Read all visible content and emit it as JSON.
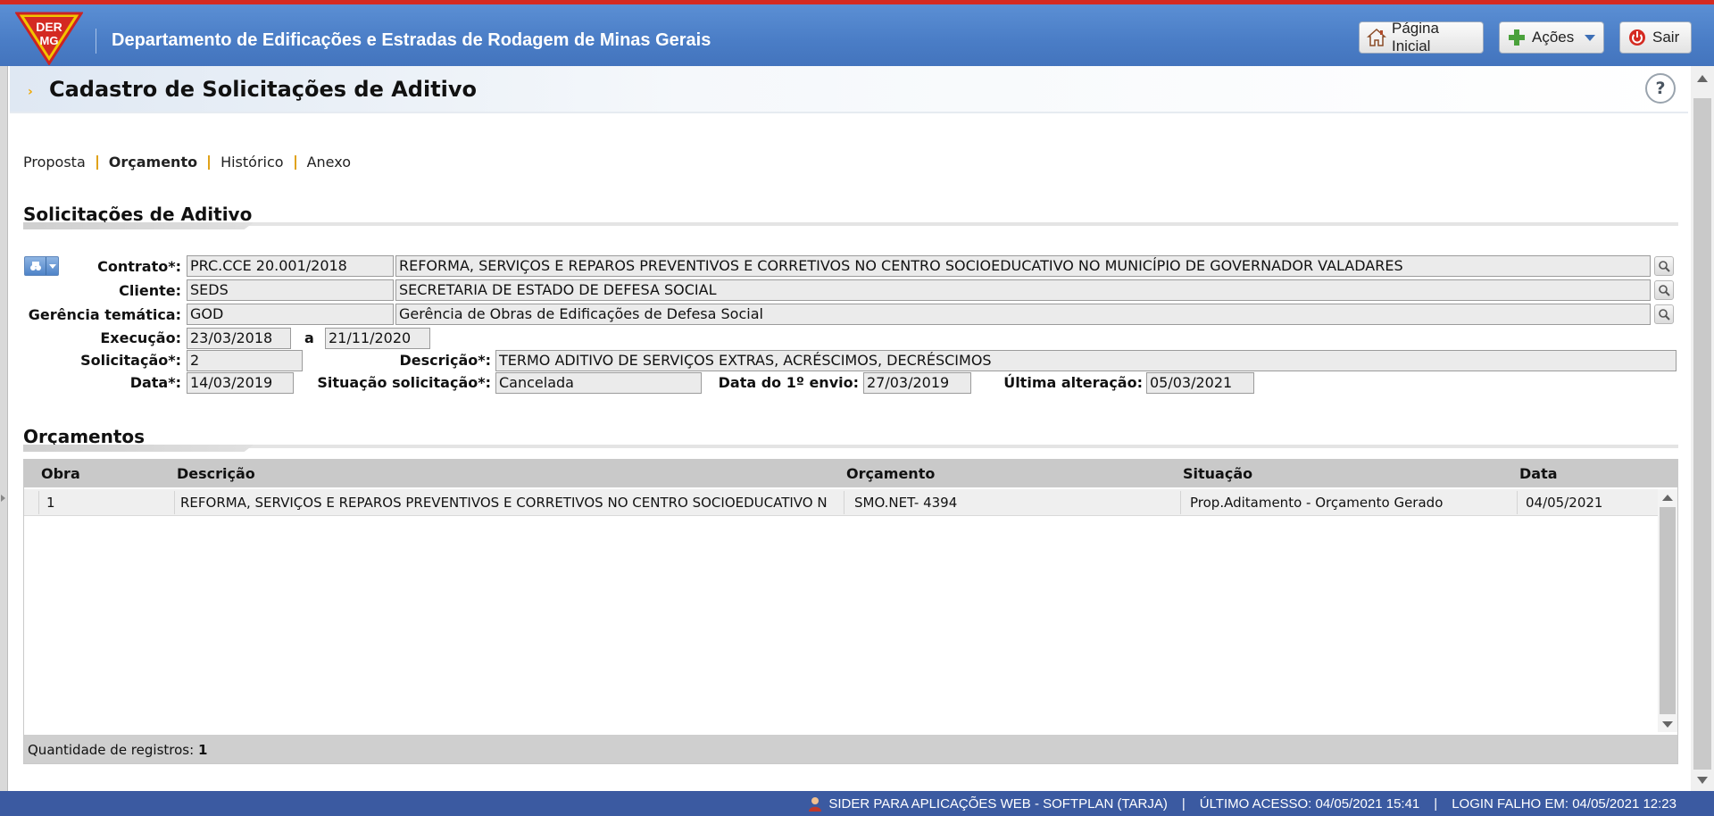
{
  "header": {
    "logo_text": [
      "DER",
      "MG"
    ],
    "app_title": "Departamento de Edificações e Estradas de Rodagem de Minas Gerais",
    "home_label": "Página Inicial",
    "actions_label": "Ações",
    "exit_label": "Sair",
    "brand_color": "#4a7dc6",
    "accent_red": "#d42a21"
  },
  "page": {
    "title": "Cadastro de Solicitações de Aditivo",
    "help_label": "?"
  },
  "tabs": [
    "Proposta",
    "Orçamento",
    "Histórico",
    "Anexo"
  ],
  "active_tab": "Orçamento",
  "section1": {
    "title": "Solicitações de Aditivo"
  },
  "form": {
    "contrato_label": "Contrato*:",
    "contrato_code": "PRC.CCE 20.001/2018",
    "contrato_desc": "REFORMA, SERVIÇOS E REPAROS PREVENTIVOS E CORRETIVOS NO CENTRO SOCIOEDUCATIVO NO MUNICÍPIO DE  GOVERNADOR VALADARES",
    "cliente_label": "Cliente:",
    "cliente_code": "SEDS",
    "cliente_desc": "SECRETARIA DE ESTADO DE DEFESA SOCIAL",
    "gerencia_label": "Gerência temática:",
    "gerencia_code": "GOD",
    "gerencia_desc": "Gerência de Obras de Edificações de Defesa Social",
    "execucao_label": "Execução:",
    "execucao_inicio": "23/03/2018",
    "execucao_a": "a",
    "execucao_fim": "21/11/2020",
    "solicitacao_label": "Solicitação*:",
    "solicitacao_value": "2",
    "descricao_label": "Descrição*:",
    "descricao_value": "TERMO ADITIVO DE SERVIÇOS EXTRAS, ACRÉSCIMOS, DECRÉSCIMOS",
    "data_label": "Data*:",
    "data_value": "14/03/2019",
    "situacao_label": "Situação solicitação*:",
    "situacao_value": "Cancelada",
    "primeiro_envio_label": "Data do 1º envio:",
    "primeiro_envio_value": "27/03/2019",
    "ultima_alteracao_label": "Última alteração:",
    "ultima_alteracao_value": "05/03/2021"
  },
  "section2": {
    "title": "Orçamentos"
  },
  "grid": {
    "columns": [
      "Obra",
      "Descrição",
      "Orçamento",
      "Situação",
      "Data"
    ],
    "rows": [
      {
        "obra": "1",
        "descricao": "REFORMA, SERVIÇOS E REPAROS PREVENTIVOS E CORRETIVOS NO CENTRO SOCIOEDUCATIVO N",
        "orcamento": "SMO.NET- 4394",
        "situacao": "Prop.Aditamento - Orçamento Gerado",
        "data": "04/05/2021"
      }
    ],
    "footer_label": "Quantidade de registros:",
    "footer_count": "1"
  },
  "footer": {
    "system": "SIDER PARA APLICAÇÕES WEB - SOFTPLAN (TARJA)",
    "sep": "|",
    "last_access": "ÚLTIMO ACESSO: 04/05/2021 15:41",
    "failed_login": "LOGIN FALHO EM: 04/05/2021 12:23"
  }
}
